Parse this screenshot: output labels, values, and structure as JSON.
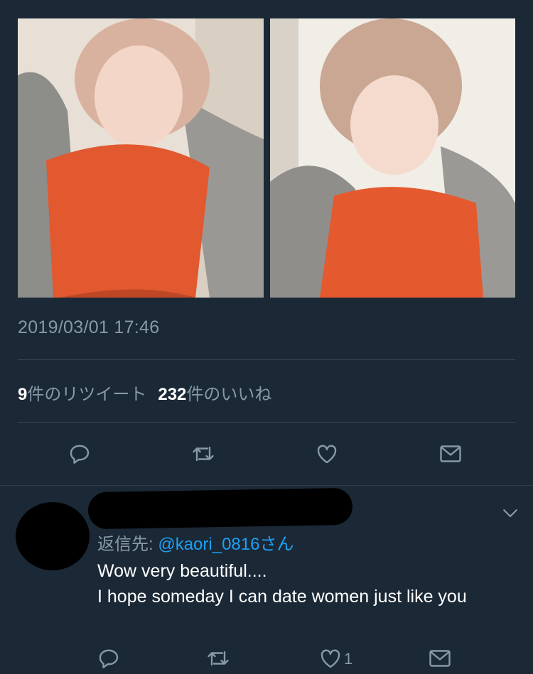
{
  "tweet": {
    "timestamp": "2019/03/01 17:46",
    "retweets_count": "9",
    "retweets_label": "件のリツイート",
    "likes_count": "232",
    "likes_label": "件のいいね",
    "icons": [
      "reply-icon",
      "retweet-icon",
      "like-icon",
      "share-icon"
    ]
  },
  "reply": {
    "reply_to_label": "返信先: ",
    "reply_to_handle": "@kaori_0816",
    "reply_to_suffix": "さん",
    "body_line1": "Wow very beautiful....",
    "body_line2": "I hope someday I can date women just like you",
    "like_count": "1",
    "icons": [
      "reply-icon",
      "retweet-icon",
      "like-icon",
      "share-icon",
      "chevron-down-icon"
    ]
  },
  "colors": {
    "background": "#1b2836",
    "secondary_text": "#8899a6",
    "link": "#1da1f2",
    "divider": "#38444d"
  }
}
